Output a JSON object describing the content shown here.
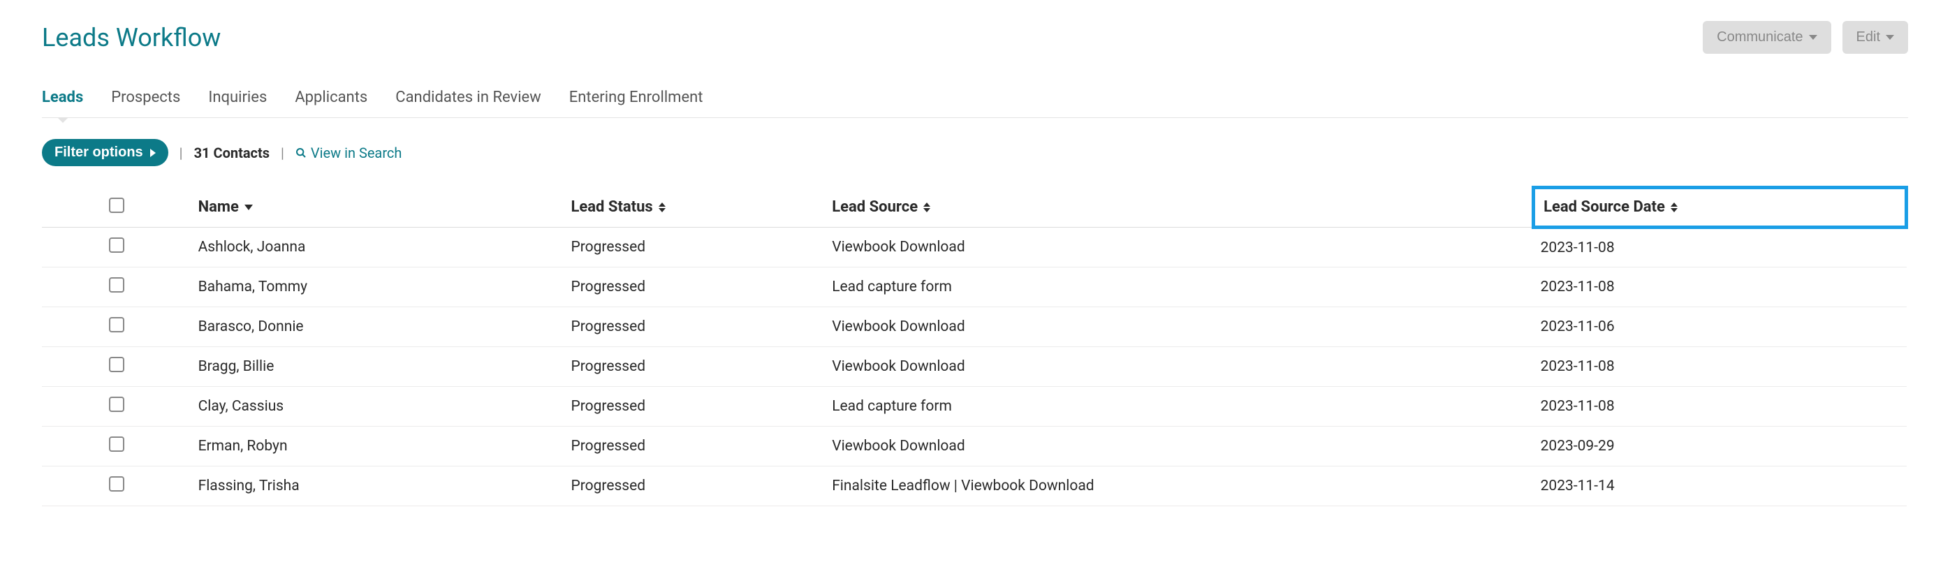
{
  "header": {
    "title": "Leads Workflow",
    "actions": {
      "communicate": "Communicate",
      "edit": "Edit"
    }
  },
  "tabs": [
    {
      "label": "Leads",
      "active": true
    },
    {
      "label": "Prospects",
      "active": false
    },
    {
      "label": "Inquiries",
      "active": false
    },
    {
      "label": "Applicants",
      "active": false
    },
    {
      "label": "Candidates in Review",
      "active": false
    },
    {
      "label": "Entering Enrollment",
      "active": false
    }
  ],
  "filter": {
    "button": "Filter options",
    "contacts": "31 Contacts",
    "view_search": "View in Search"
  },
  "table": {
    "headers": {
      "name": "Name",
      "status": "Lead Status",
      "source": "Lead Source",
      "date": "Lead Source Date"
    },
    "rows": [
      {
        "name": "Ashlock, Joanna",
        "status": "Progressed",
        "source": "Viewbook Download",
        "date": "2023-11-08"
      },
      {
        "name": "Bahama, Tommy",
        "status": "Progressed",
        "source": "Lead capture form",
        "date": "2023-11-08"
      },
      {
        "name": "Barasco, Donnie",
        "status": "Progressed",
        "source": "Viewbook Download",
        "date": "2023-11-06"
      },
      {
        "name": "Bragg, Billie",
        "status": "Progressed",
        "source": "Viewbook Download",
        "date": "2023-11-08"
      },
      {
        "name": "Clay, Cassius",
        "status": "Progressed",
        "source": "Lead capture form",
        "date": "2023-11-08"
      },
      {
        "name": "Erman, Robyn",
        "status": "Progressed",
        "source": "Viewbook Download",
        "date": "2023-09-29"
      },
      {
        "name": "Flassing, Trisha",
        "status": "Progressed",
        "source": "Finalsite Leadflow | Viewbook Download",
        "date": "2023-11-14"
      }
    ]
  }
}
